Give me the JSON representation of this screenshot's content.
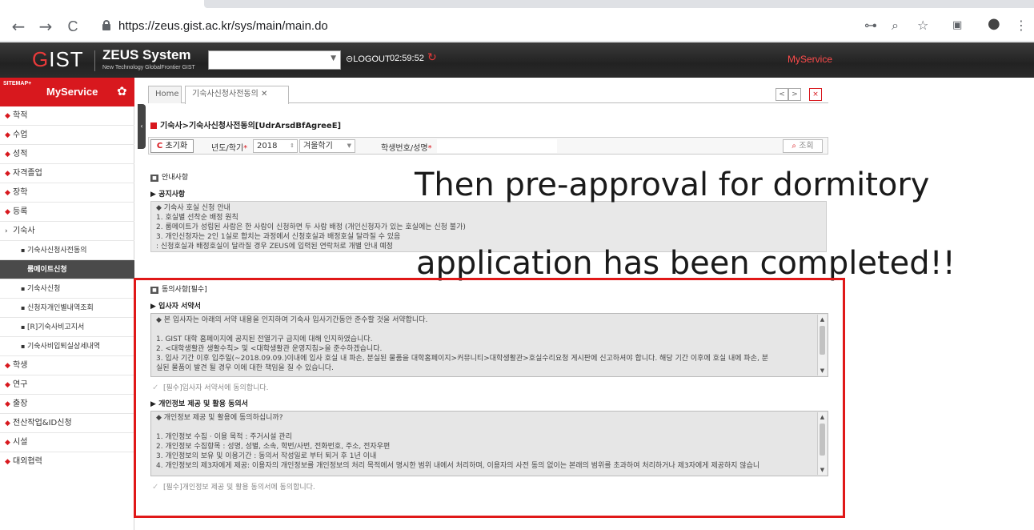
{
  "browser": {
    "url": "https://zeus.gist.ac.kr/sys/main/main.do",
    "nav": {
      "back": "←",
      "forward": "→",
      "reload": "C"
    },
    "right_icons": [
      "key-icon",
      "zoom-icon",
      "star-icon",
      "cast-icon",
      "account-icon",
      "menu-icon"
    ],
    "right_glyphs": {
      "key": "⊶",
      "zoom": "⌕",
      "star": "☆",
      "cast": "▣",
      "account": "●",
      "menu": "⋮"
    }
  },
  "header": {
    "logo_g": "G",
    "logo_rest": "IST",
    "title": "ZEUS System",
    "subtitle": "New Technology GlobalFrontier GIST",
    "logout": "LOGOUT",
    "timer": "02:59:52",
    "myservice": "MyService"
  },
  "sidebar": {
    "sitemap": "SITEMAP+",
    "title": "MyService",
    "items": [
      {
        "label": "학적"
      },
      {
        "label": "수업"
      },
      {
        "label": "성적"
      },
      {
        "label": "자격졸업"
      },
      {
        "label": "장학"
      },
      {
        "label": "등록"
      },
      {
        "label": "기숙사"
      }
    ],
    "subitems": [
      {
        "label": "기숙사신청사전동의"
      },
      {
        "label": "룸메이트신청"
      },
      {
        "label": "기숙사신청"
      },
      {
        "label": "신청자개인별내역조회"
      },
      {
        "label": "[R]기숙사비고지서"
      },
      {
        "label": "기숙사비입퇴실상세내역"
      }
    ],
    "items2": [
      {
        "label": "학생"
      },
      {
        "label": "연구"
      },
      {
        "label": "출장"
      },
      {
        "label": "전산작업&ID신청"
      },
      {
        "label": "시설"
      },
      {
        "label": "대외협력"
      }
    ]
  },
  "tabs": {
    "home": "Home",
    "active": "기숙사신청사전동의 ✕",
    "prev": "<",
    "next": ">",
    "close": "×"
  },
  "page": {
    "title": "기숙사>기숙사신청사전동의[UdrArsdBfAgreeE]",
    "reset": "초기화",
    "year_label": "년도/학기",
    "year": "2018",
    "semester": "겨울학기",
    "student_label": "학생번호/성명",
    "search": "조회"
  },
  "notice": {
    "section": "안내사항",
    "sub": "공지사항",
    "lines": [
      "◆ 기숙사 호실 신청 안내",
      "1. 호실별 선착순 배정 원칙",
      "2. 룸메이트가 성립된 사람은 한 사람이 신청하면 두 사람 배정 (개인신청자가 있는 호실에는 신청 불가)",
      "3. 개인신청자는 2인 1실로 합치는 과정에서 신청호실과 배정호실 달라질 수 있음",
      "   : 신청호실과 배정호실이 달라질 경우 ZEUS에 입력된 연락처로 개별 안내 예정"
    ]
  },
  "overlay": {
    "line1": "Then  pre-approval  for  dormitory",
    "line2": "application has been completed!!"
  },
  "agreement": {
    "section": "동의사항[필수]",
    "pledge_title": "입사자 서약서",
    "pledge_lines": [
      "◆ 본 입사자는 아래의 서약 내용을 인지하여 기숙사 입사기간동안 준수할 것을 서약합니다.",
      "",
      "1. GIST 대학 홈페이지에 공지된 전열기구 금지에 대해 인지하였습니다.",
      "2. <대학생활관 생활수칙> 및 <대학생활관 운영지침>을 준수하겠습니다.",
      "3. 입사 기간 이후 입주일(~2018.09.09.)이내에 입사 호실 내 파손, 분실된 물품을 대학홈페이지>커뮤니티>대학생활관>호실수리요청 게시판에 신고하셔야 합니다. 해당 기간 이후에 호실 내에 파손, 분",
      "실된 물품이 발견 될 경우 이에 대한 책임을 질 수 있습니다."
    ],
    "pledge_agree": "[필수]입사자 서약서에 동의합니다.",
    "privacy_title": "개인정보 제공 및 활용 동의서",
    "privacy_lines": [
      "◆ 개인정보 제공 및 활용에 동의하십니까?",
      "",
      "1. 개인정보 수집 · 이용 목적 :   주거시설 관리",
      "2. 개인정보 수집항목 :   성명, 성별, 소속, 학번/사번, 전화번호, 주소, 전자우편",
      "3. 개인정보의 보유 및 이용기간 : 동의서 작성일로 부터 퇴거 후 1년 이내",
      "4. 개인정보의 제3자에게 제공: 이용자의 개인정보를 개인정보의 처리 목적에서 명시한 범위 내에서 처리하며, 이용자의 사전 동의 없이는 본래의 범위를 초과하여 처리하거나 제3자에게 제공하지 않습니"
    ],
    "privacy_agree": "[필수]개인정보 제공 및 활용 동의서에 동의합니다."
  },
  "colors": {
    "accent_red": "#d8181e",
    "highlight_box": "#e01818",
    "header_dark": "#2b2b2b"
  }
}
